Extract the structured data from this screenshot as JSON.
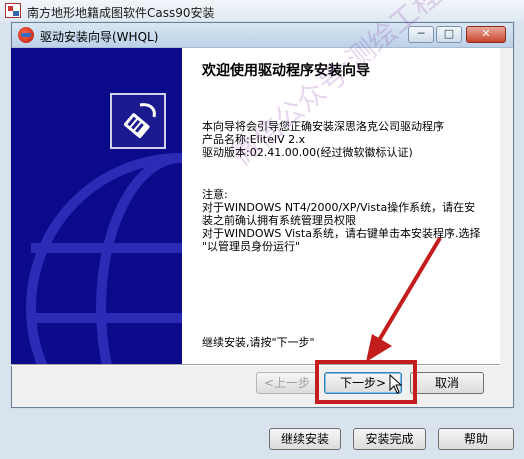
{
  "app": {
    "title": "南方地形地籍成图软件Cass90安装"
  },
  "dialog": {
    "title": "驱动安装向导(WHQL)",
    "heading": "欢迎使用驱动程序安装向导",
    "intro_lines": "本向导将会引导您正确安装深思洛克公司驱动程序\n产品名称:EliteIV 2.x\n驱动版本:02.41.00.00(经过微软徽标认证)",
    "note_lines": "注意:\n对于WINDOWS NT4/2000/XP/Vista操作系统，请在安\n装之前确认拥有系统管理员权限\n对于WINDOWS Vista系统，请右键单击本安装程序.选择\n\"以管理员身份运行\"",
    "continue_text": "继续安装,请按\"下一步\"",
    "watermark": "微信公众号:测绘工程人",
    "back_label": "<上一步",
    "next_label": "下一步>",
    "cancel_label": "取消"
  },
  "window_controls": {
    "minimize": "─",
    "maximize": "□",
    "close": "✕"
  },
  "footer": {
    "continue_label": "继续安装",
    "finish_label": "安装完成",
    "help_label": "帮助"
  },
  "colors": {
    "banner": "#0a0a8a",
    "highlight": "#c41d1d"
  }
}
